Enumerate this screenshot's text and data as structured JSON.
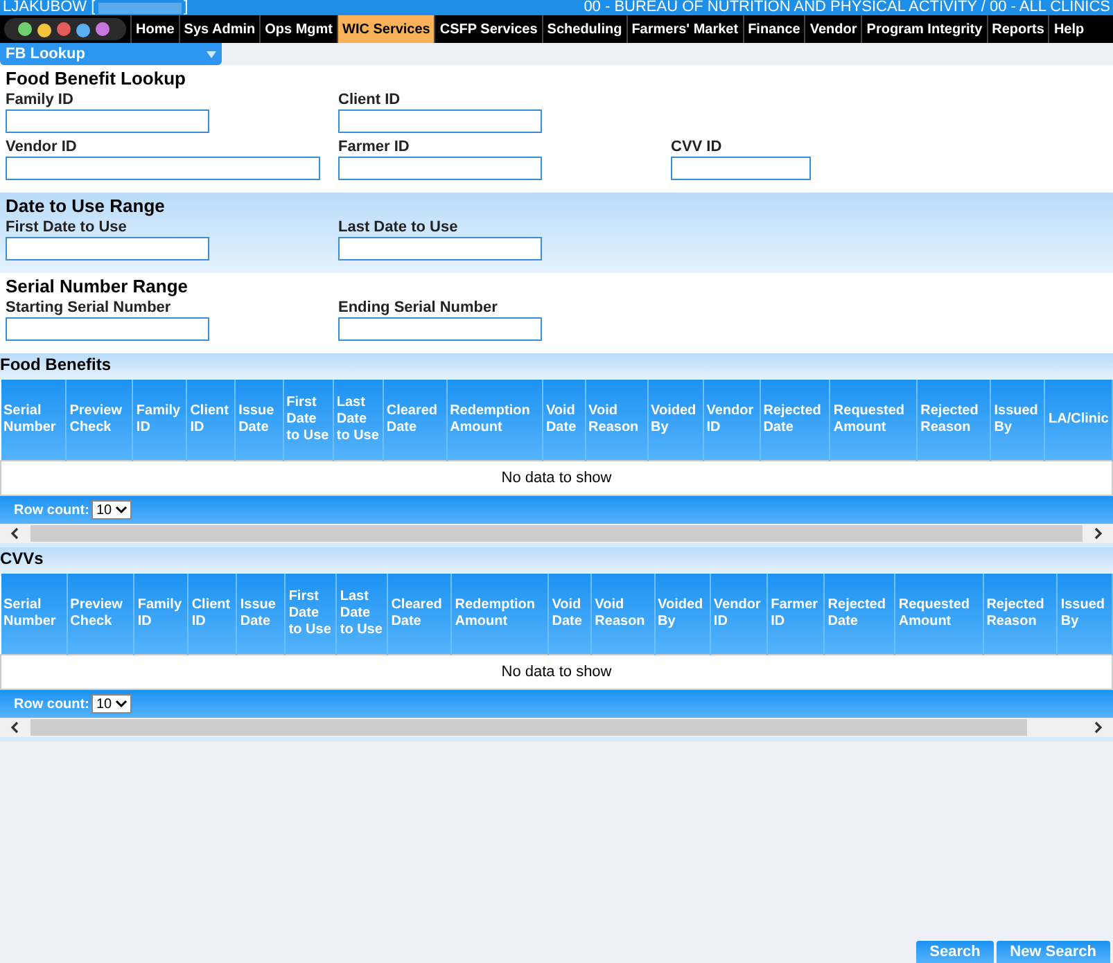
{
  "header": {
    "user": "LJAKUBOW [",
    "user_end": "]",
    "agency": "00 - BUREAU OF NUTRITION AND PHYSICAL ACTIVITY / 00 - ALL CLINICS"
  },
  "nav": [
    {
      "label": "Home",
      "selected": false
    },
    {
      "label": "Sys Admin",
      "selected": false
    },
    {
      "label": "Ops Mgmt",
      "selected": false
    },
    {
      "label": "WIC Services",
      "selected": true
    },
    {
      "label": "CSFP Services",
      "selected": false
    },
    {
      "label": "Scheduling",
      "selected": false
    },
    {
      "label": "Farmers' Market",
      "selected": false
    },
    {
      "label": "Finance",
      "selected": false
    },
    {
      "label": "Vendor",
      "selected": false
    },
    {
      "label": "Program Integrity",
      "selected": false
    },
    {
      "label": "Reports",
      "selected": false
    },
    {
      "label": "Help",
      "selected": false
    }
  ],
  "page_select": "FB Lookup",
  "sections": [
    {
      "title": "Food Benefit Lookup",
      "rows": [
        [
          {
            "label": "Family ID"
          },
          {
            "label": "Client ID"
          }
        ],
        [
          {
            "label": "Vendor ID"
          },
          {
            "label": "Farmer ID"
          },
          {
            "label": "CVV ID"
          }
        ]
      ]
    },
    {
      "title": "Date to Use Range",
      "rows": [
        [
          {
            "label": "First Date to Use"
          },
          {
            "label": "Last Date to Use"
          }
        ]
      ]
    },
    {
      "title": "Serial Number Range",
      "rows": [
        [
          {
            "label": "Starting Serial Number"
          },
          {
            "label": "Ending Serial Number"
          }
        ]
      ]
    }
  ],
  "tables": [
    {
      "title": "Food Benefits",
      "columns": [
        "Serial Number",
        "Preview Check",
        "Family ID",
        "Client ID",
        "Issue Date",
        "First Date to Use",
        "Last Date to Use",
        "Cleared Date",
        "Redemption Amount",
        "Void Date",
        "Void Reason",
        "Voided By",
        "Vendor ID",
        "Rejected Date",
        "Requested Amount",
        "Rejected Reason",
        "Issued By",
        "LA/Clinic"
      ],
      "empty": "No data to show",
      "row_count_label": "Row count:",
      "row_count": "10"
    },
    {
      "title": "CVVs",
      "columns": [
        "Serial Number",
        "Preview Check",
        "Family ID",
        "Client ID",
        "Issue Date",
        "First Date to Use",
        "Last Date to Use",
        "Cleared Date",
        "Redemption Amount",
        "Void Date",
        "Void Reason",
        "Voided By",
        "Vendor ID",
        "Farmer ID",
        "Rejected Date",
        "Requested Amount",
        "Rejected Reason",
        "Issued By"
      ],
      "empty": "No data to show",
      "row_count_label": "Row count:",
      "row_count": "10"
    }
  ],
  "buttons": [
    "Search",
    "New Search"
  ]
}
